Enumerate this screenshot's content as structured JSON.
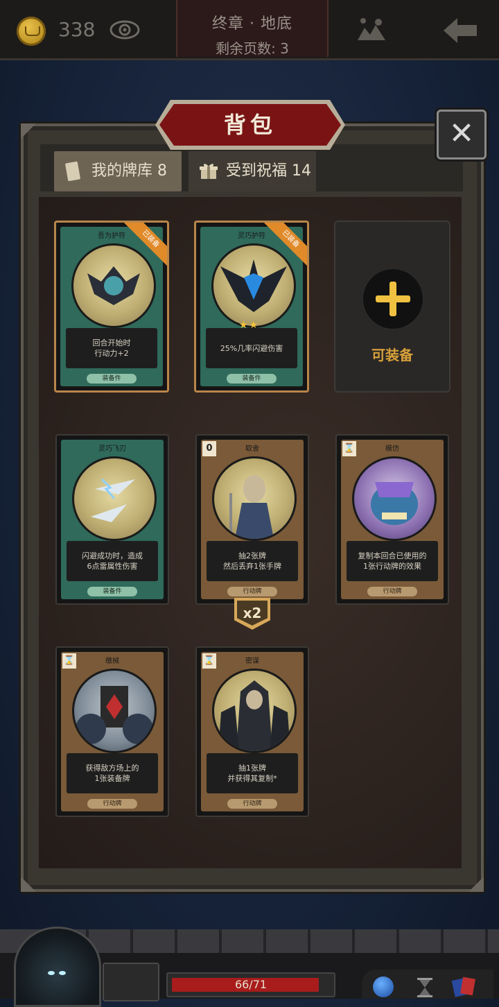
{
  "topbar": {
    "coins": "338",
    "chapter_title": "终章 · 地底",
    "pages_left": "剩余页数: 3"
  },
  "modal": {
    "title": "背包",
    "tabs": [
      {
        "label": "我的牌库 8",
        "active": true
      },
      {
        "label": "受到祝福 14",
        "active": false
      }
    ],
    "empty_slot_label": "可装备",
    "badge": "x2"
  },
  "cards": [
    {
      "name": "吾为护符",
      "desc": "回合开始时\n行动力+2",
      "type": "装备件",
      "ribbon": "已装备",
      "cost": ""
    },
    {
      "name": "灵巧护符",
      "desc": "25%几率闪避伤害",
      "type": "装备件",
      "ribbon": "已装备",
      "stars": "★★",
      "cost": ""
    },
    {
      "name": "灵巧飞刃",
      "desc": "闪避成功时，造成\n6点雷属性伤害",
      "type": "装备件",
      "ribbon": "",
      "cost": ""
    },
    {
      "name": "取舍",
      "desc": "抽2张牌\n然后丢弃1张手牌",
      "type": "行动牌",
      "ribbon": "",
      "cost": "0"
    },
    {
      "name": "模仿",
      "desc": "复制本回合已使用的\n1张行动牌的效果",
      "type": "行动牌",
      "ribbon": "",
      "cost": "⌛"
    },
    {
      "name": "缴械",
      "desc": "获得敌方场上的\n1张装备牌",
      "type": "行动牌",
      "ribbon": "",
      "cost": "⌛"
    },
    {
      "name": "密谋",
      "desc": "抽1张牌\n并获得其复制*",
      "type": "行动牌",
      "ribbon": "",
      "cost": "⌛"
    }
  ],
  "hp": {
    "text": "66/71",
    "fraction": 0.93
  }
}
